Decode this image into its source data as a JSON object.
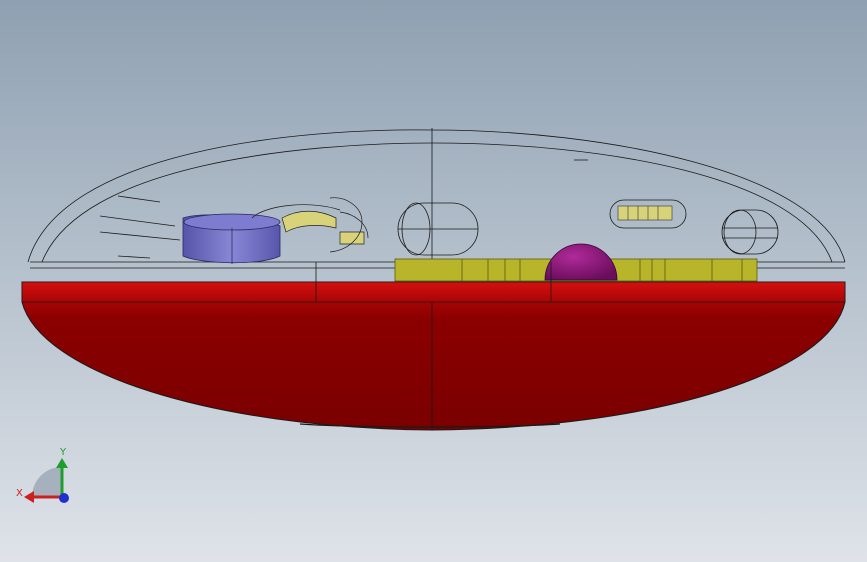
{
  "viewport": {
    "background_top": "#8fa0b2",
    "background_bottom": "#dfe3e9"
  },
  "model": {
    "lower_shell_color": "#8b0000",
    "lower_shell_highlight": "#c20a0a",
    "edge_color": "#1a1a1a",
    "pcb_color": "#b9b52a",
    "battery_color": "#6d6bc0",
    "button_ball_color": "#8a1477",
    "spring_color": "#d8d27a"
  },
  "triad": {
    "x_label": "X",
    "y_label": "Y",
    "x_color": "#cc1f1f",
    "y_color": "#1f9e2e",
    "z_color": "#1f2fcc",
    "icon": "coordinate-triad-icon"
  }
}
